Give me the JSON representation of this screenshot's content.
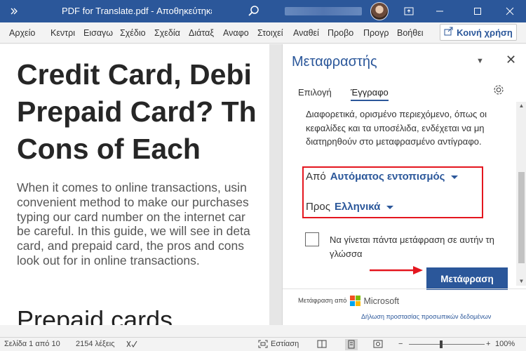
{
  "titlebar": {
    "title": "PDF for Translate.pdf - Αποθηκεύτηκε",
    "qat_icon": "chevron-more-icon",
    "minimize": "–",
    "maximize": "☐",
    "close": "✕"
  },
  "menu": {
    "tabs": [
      "Αρχείο",
      "Κεντρι",
      "Εισαγω",
      "Σχέδιο",
      "Σχεδία",
      "Διάταξ",
      "Αναφο",
      "Στοιχεί",
      "Αναθεί",
      "Προβο",
      "Προγρ",
      "Βοήθει"
    ],
    "share_label": "Κοινή χρήση"
  },
  "document": {
    "title_lines": [
      "Credit Card, Debi",
      "Prepaid Card? Th",
      "Cons of Each"
    ],
    "body_lines": [
      "When it comes to online transactions, usin",
      "convenient method to make our purchases",
      "typing our card number on the internet car",
      "be careful. In this guide, we will see in deta",
      "card, and prepaid card, the pros and cons",
      "look out for in online transactions."
    ],
    "heading2": "Prepaid cards"
  },
  "translator": {
    "title": "Μεταφραστής",
    "tabs": [
      "Επιλογή",
      "Έγγραφο"
    ],
    "info_text": "Διαφορετικά, ορισμένο περιεχόμενο, όπως οι κεφαλίδες και τα υποσέλιδα, ενδέχεται να μη διατηρηθούν στο μεταφρασμένο αντίγραφο.",
    "from_label": "Από",
    "from_value": "Αυτόματος εντοπισμός",
    "to_label": "Προς",
    "to_value": "Ελληνικά",
    "always_translate_label": "Να γίνεται πάντα μετάφραση σε αυτήν τη γλώσσα",
    "translate_button": "Μετάφραση",
    "powered_by": "Μετάφραση από",
    "provider": "Microsoft",
    "privacy_link": "Δήλωση προστασίας προσωπικών δεδομένων",
    "highlight_color": "#e4161f"
  },
  "statusbar": {
    "page": "Σελίδα 1 από 10",
    "words": "2154 λέξεις",
    "focus": "Εστίαση",
    "zoom": "100%",
    "zoom_minus": "−",
    "zoom_plus": "+"
  },
  "colors": {
    "accent": "#2b579a",
    "annotation_red": "#e4161f"
  }
}
